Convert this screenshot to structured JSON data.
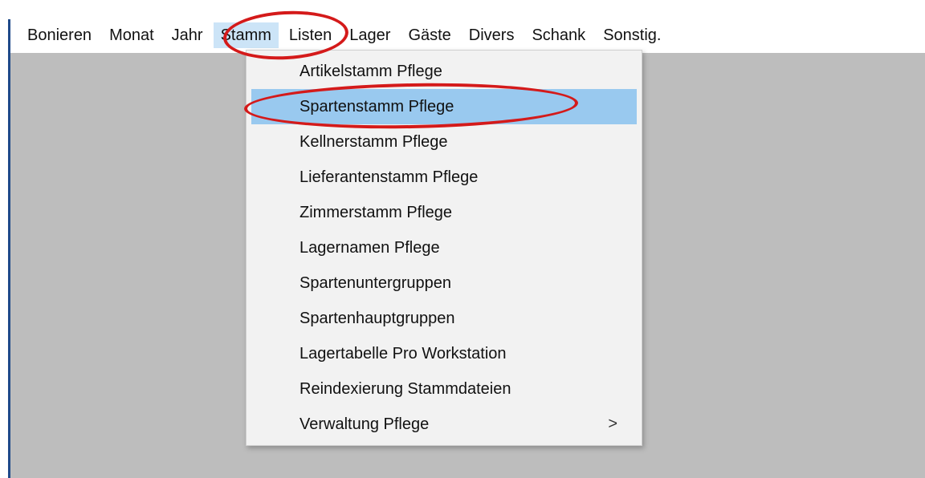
{
  "menubar": {
    "items": [
      {
        "label": "Bonieren"
      },
      {
        "label": "Monat"
      },
      {
        "label": "Jahr"
      },
      {
        "label": "Stamm"
      },
      {
        "label": "Listen"
      },
      {
        "label": "Lager"
      },
      {
        "label": "Gäste"
      },
      {
        "label": "Divers"
      },
      {
        "label": "Schank"
      },
      {
        "label": "Sonstig."
      }
    ]
  },
  "stamm_menu": {
    "items": [
      {
        "label": "Artikelstamm Pflege"
      },
      {
        "label": "Spartenstamm Pflege"
      },
      {
        "label": "Kellnerstamm Pflege"
      },
      {
        "label": "Lieferantenstamm Pflege"
      },
      {
        "label": "Zimmerstamm Pflege"
      },
      {
        "label": "Lagernamen Pflege"
      },
      {
        "label": "Spartenuntergruppen"
      },
      {
        "label": "Spartenhauptgruppen"
      },
      {
        "label": "Lagertabelle Pro Workstation"
      },
      {
        "label": "Reindexierung Stammdateien"
      },
      {
        "label": "Verwaltung Pflege",
        "submenu_arrow": ">"
      }
    ],
    "highlighted_item": "Spartenstamm Pflege"
  },
  "colors": {
    "menu_highlight": "#99c9ef",
    "active_menubar": "#cce4f7",
    "annotation": "#d41a1a",
    "client_background": "#bdbdbd",
    "dropdown_background": "#f2f2f2"
  }
}
